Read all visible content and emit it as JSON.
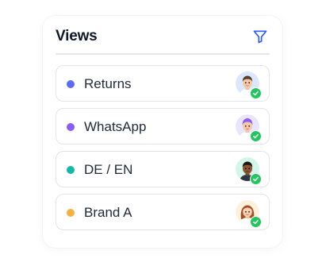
{
  "panel": {
    "title": "Views",
    "filter_icon": "filter-icon",
    "accent_color": "#2f5bff"
  },
  "views": [
    {
      "label": "Returns",
      "dot_color": "#5b6cf6",
      "avatar": "male-avatar-icon",
      "avatar_bg": "#dbe7ff",
      "status": "check-icon"
    },
    {
      "label": "WhatsApp",
      "dot_color": "#8b5cf6",
      "avatar": "purple-hair-avatar-icon",
      "avatar_bg": "#ebe4ff",
      "status": "check-icon"
    },
    {
      "label": "DE / EN",
      "dot_color": "#14b8a6",
      "avatar": "dark-skin-avatar-icon",
      "avatar_bg": "#d3f5ea",
      "status": "check-icon"
    },
    {
      "label": "Brand A",
      "dot_color": "#f5b041",
      "avatar": "female-avatar-icon",
      "avatar_bg": "#fff0dc",
      "status": "check-icon"
    }
  ],
  "status_color": "#22c55e"
}
